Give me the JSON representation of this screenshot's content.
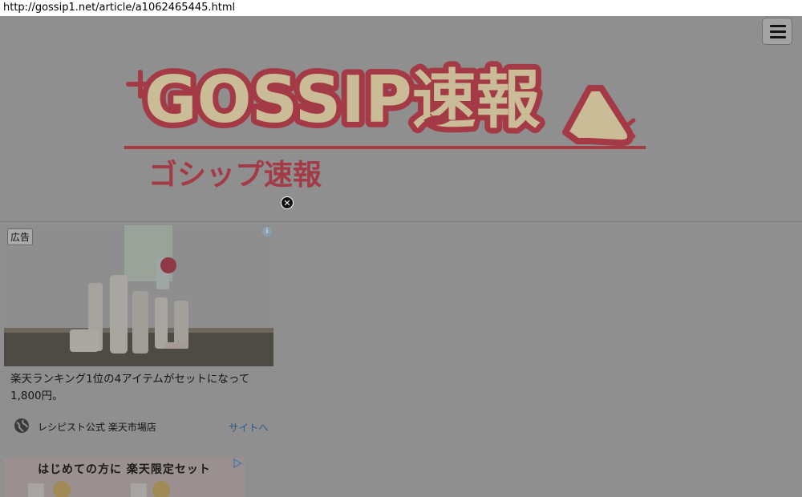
{
  "browser": {
    "url": "http://gossip1.net/article/a1062465445.html"
  },
  "header": {
    "logo_text": "GOSSIP速報",
    "logo_subtitle": "ゴシップ速報"
  },
  "ad1": {
    "badge": "広告",
    "info": "i",
    "text": "楽天ランキング1位の4アイテムがセットになって1,800円。",
    "advertiser": "レシピスト公式 楽天市場店",
    "cta": "サイトへ"
  },
  "ad2": {
    "title": "はじめての方に 楽天限定セット"
  },
  "colors": {
    "logo_red": "#a33a45",
    "logo_cream": "#c9bc96",
    "link_blue": "#2e5b8a",
    "overlay_gray": "#8f8f8f"
  },
  "icons": {
    "menu": "hamburger-icon",
    "close": "close-circle-icon",
    "globe": "globe-icon",
    "adchoices": "adchoices-icon"
  }
}
